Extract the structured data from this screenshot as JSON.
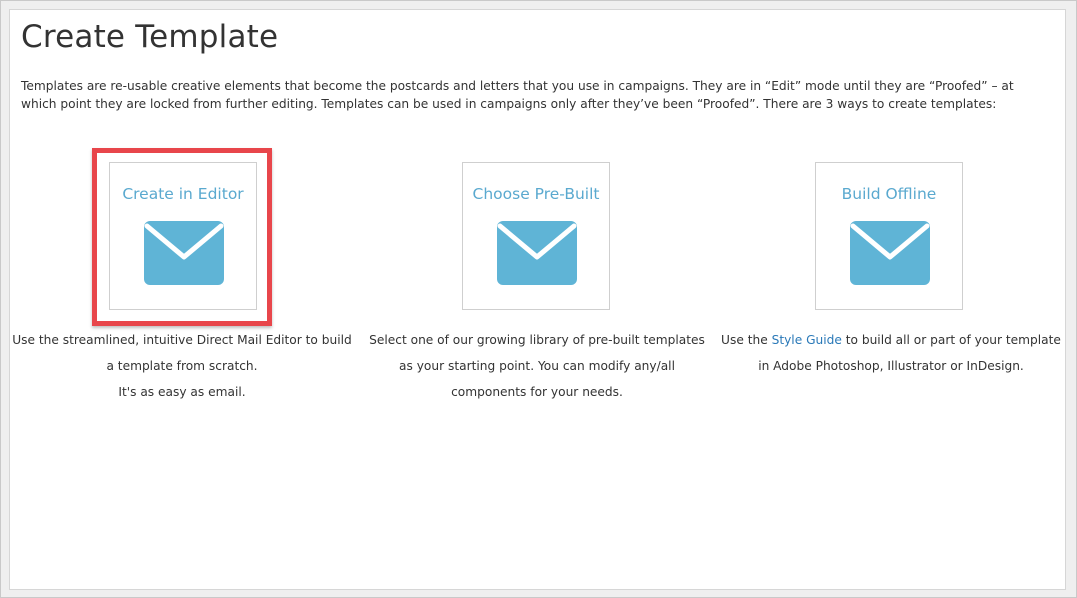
{
  "page": {
    "title": "Create Template",
    "intro": "Templates are re-usable creative elements that become the postcards and letters that you use in campaigns. They are in “Edit” mode until they are “Proofed” – at which point they are locked from further editing. Templates can be used in campaigns only after they’ve been “Proofed”. There are 3 ways to create templates:"
  },
  "options": [
    {
      "title": "Create in Editor",
      "icon": "envelope-icon",
      "highlighted": true,
      "desc_lines": [
        "Use the streamlined, intuitive Direct Mail Editor to build",
        "a template from scratch.",
        "It's as easy as email."
      ]
    },
    {
      "title": "Choose Pre-Built",
      "icon": "envelope-icon",
      "highlighted": false,
      "desc_lines": [
        "Select one of our growing library of pre-built templates",
        "as your starting point. You can modify any/all",
        "components for your needs."
      ]
    },
    {
      "title": "Build Offline",
      "icon": "envelope-icon",
      "highlighted": false,
      "desc_before_link": "Use the ",
      "desc_link": "Style Guide",
      "desc_after_link": " to build all or part of your template",
      "desc_line2": "in Adobe Photoshop, Illustrator or InDesign."
    }
  ],
  "colors": {
    "accent": "#5aa9cf",
    "icon": "#5fb4d6",
    "highlight": "#e8464b",
    "link": "#2a79b8",
    "text": "#333333"
  }
}
